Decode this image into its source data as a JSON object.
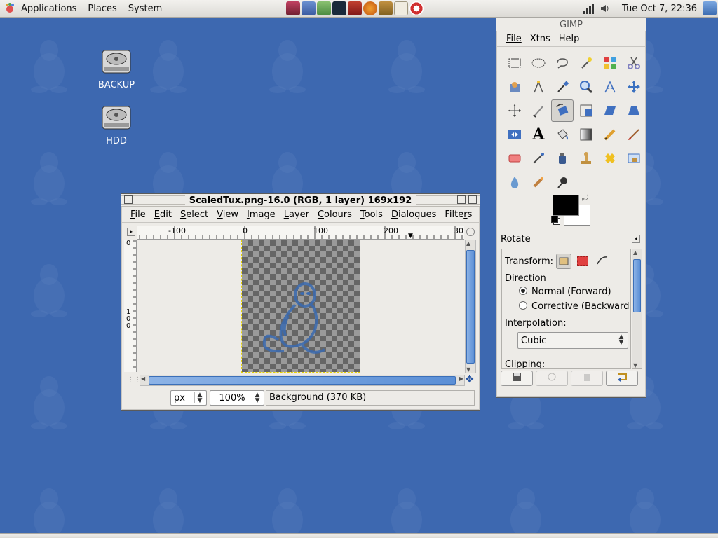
{
  "top_panel": {
    "menus": [
      "Applications",
      "Places",
      "System"
    ],
    "clock": "Tue Oct  7, 22:36"
  },
  "desktop_icons": [
    {
      "label": "BACKUP",
      "icon": "hard-disk-icon"
    },
    {
      "label": "HDD",
      "icon": "hard-disk-icon"
    }
  ],
  "image_window": {
    "title": "ScaledTux.png-16.0 (RGB, 1 layer) 169x192",
    "menus": [
      {
        "label": "File",
        "u": "F"
      },
      {
        "label": "Edit",
        "u": "E"
      },
      {
        "label": "Select",
        "u": "S"
      },
      {
        "label": "View",
        "u": "V"
      },
      {
        "label": "Image",
        "u": "I"
      },
      {
        "label": "Layer",
        "u": "L"
      },
      {
        "label": "Colours",
        "u": "C"
      },
      {
        "label": "Tools",
        "u": "T"
      },
      {
        "label": "Dialogues",
        "u": "D"
      },
      {
        "label": "Filters",
        "u": "r"
      }
    ],
    "ruler_labels": [
      "-100",
      "0",
      "100",
      "200",
      "30"
    ],
    "vruler_labels": [
      "0",
      "1",
      "0",
      "0"
    ],
    "unit": "px",
    "zoom": "100%",
    "status": "Background (370 KB)"
  },
  "toolbox": {
    "title": "GIMP",
    "menus": [
      "File",
      "Xtns",
      "Help"
    ],
    "tool_options": {
      "title": "Rotate",
      "transform_label": "Transform:",
      "direction_label": "Direction",
      "direction_options": [
        "Normal (Forward)",
        "Corrective (Backward)"
      ],
      "direction_selected": 0,
      "interpolation_label": "Interpolation:",
      "interpolation_value": "Cubic",
      "clipping_label": "Clipping:"
    },
    "colors": {
      "foreground": "#000000",
      "background": "#ffffff"
    }
  }
}
